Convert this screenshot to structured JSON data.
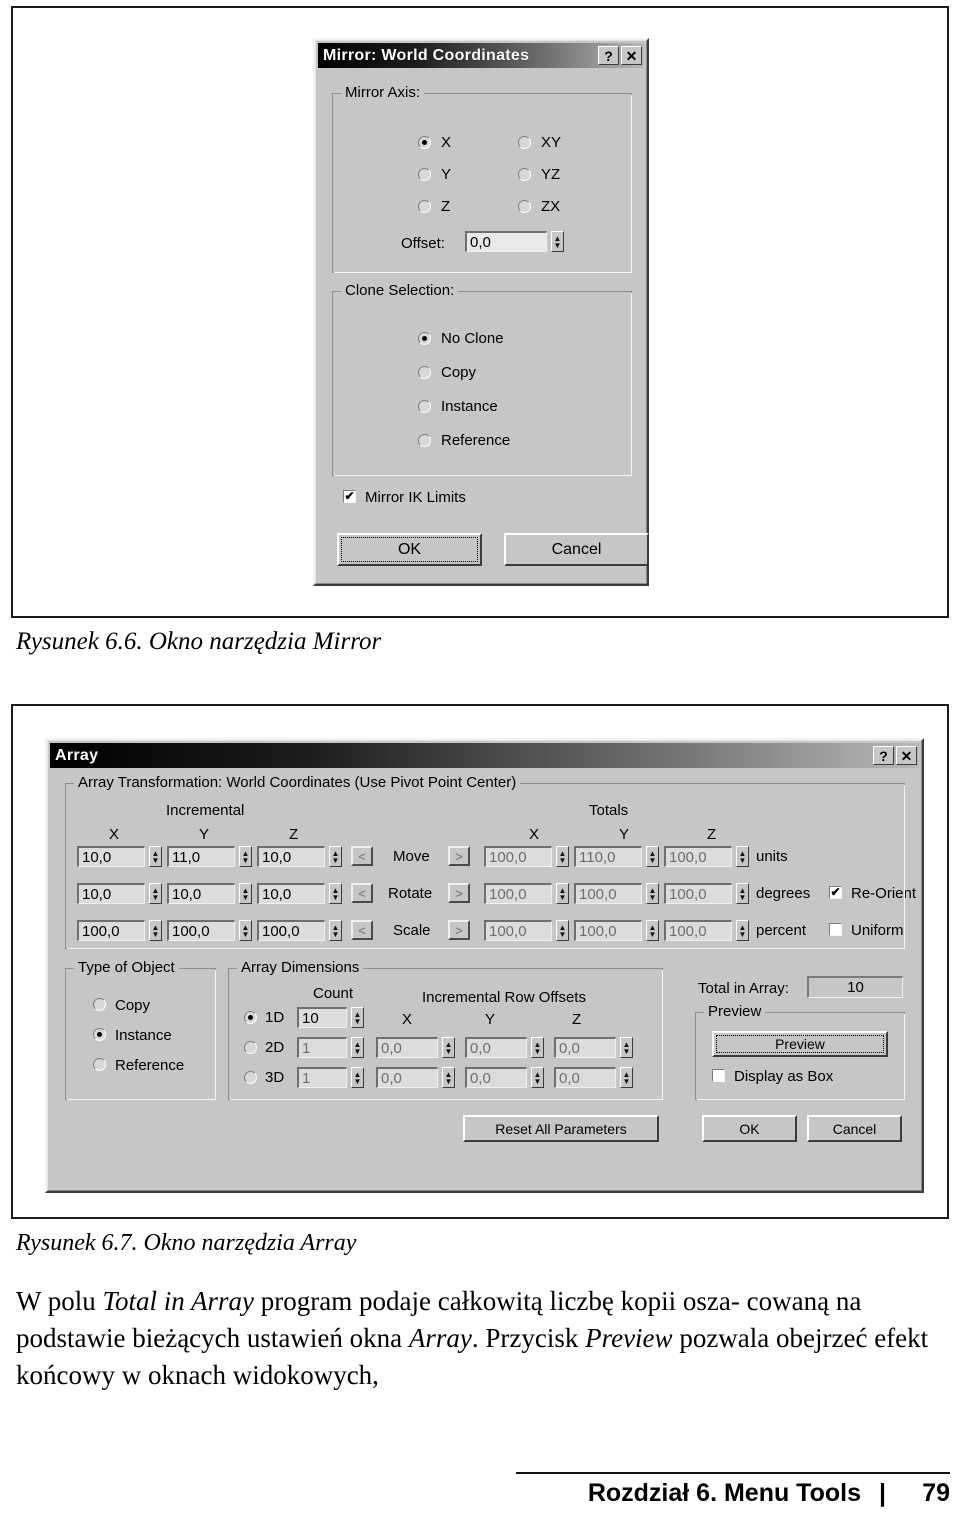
{
  "figures": [
    {
      "caption": "Rysunek 6.6. Okno narzędzia Mirror"
    },
    {
      "caption": "Rysunek 6.7. Okno narzędzia Array"
    }
  ],
  "mirror_dialog": {
    "title": "Mirror: World Coordinates",
    "help_button": "?",
    "close_button": "✕",
    "mirror_axis": {
      "group_label": "Mirror Axis:",
      "options": [
        {
          "label": "X",
          "selected": true
        },
        {
          "label": "Y",
          "selected": false
        },
        {
          "label": "Z",
          "selected": false
        },
        {
          "label": "XY",
          "selected": false
        },
        {
          "label": "YZ",
          "selected": false
        },
        {
          "label": "ZX",
          "selected": false
        }
      ],
      "offset_label": "Offset:",
      "offset_value": "0,0"
    },
    "clone_selection": {
      "group_label": "Clone Selection:",
      "options": [
        {
          "label": "No Clone",
          "selected": true
        },
        {
          "label": "Copy",
          "selected": false
        },
        {
          "label": "Instance",
          "selected": false
        },
        {
          "label": "Reference",
          "selected": false
        }
      ]
    },
    "mirror_ik_limits": {
      "label": "Mirror IK Limits",
      "checked": true,
      "mark": "✔"
    },
    "ok_label": "OK",
    "cancel_label": "Cancel"
  },
  "array_dialog": {
    "title": "Array",
    "help_button": "?",
    "close_button": "✕",
    "transformation": {
      "group_label": "Array Transformation: World Coordinates (Use Pivot Point Center)",
      "incremental_header": "Incremental",
      "totals_header": "Totals",
      "axis_headers": [
        "X",
        "Y",
        "Z"
      ],
      "arrow_left": "<",
      "arrow_right": ">",
      "rows": [
        {
          "name": "Move",
          "incremental": [
            "10,0",
            "11,0",
            "10,0"
          ],
          "totals": [
            "100,0",
            "110,0",
            "100,0"
          ],
          "unit": "units",
          "checkbox": null
        },
        {
          "name": "Rotate",
          "incremental": [
            "10,0",
            "10,0",
            "10,0"
          ],
          "totals": [
            "100,0",
            "100,0",
            "100,0"
          ],
          "unit": "degrees",
          "checkbox": {
            "label": "Re-Orient",
            "checked": true,
            "mark": "✔"
          }
        },
        {
          "name": "Scale",
          "incremental": [
            "100,0",
            "100,0",
            "100,0"
          ],
          "totals": [
            "100,0",
            "100,0",
            "100,0"
          ],
          "unit": "percent",
          "checkbox": {
            "label": "Uniform",
            "checked": false,
            "mark": ""
          }
        }
      ]
    },
    "type_of_object": {
      "group_label": "Type of Object",
      "options": [
        {
          "label": "Copy",
          "selected": false
        },
        {
          "label": "Instance",
          "selected": true
        },
        {
          "label": "Reference",
          "selected": false
        }
      ]
    },
    "array_dimensions": {
      "group_label": "Array Dimensions",
      "count_header": "Count",
      "offsets_header": "Incremental Row Offsets",
      "axis_headers": [
        "X",
        "Y",
        "Z"
      ],
      "rows": [
        {
          "label": "1D",
          "selected": true,
          "count": "10",
          "offsets": []
        },
        {
          "label": "2D",
          "selected": false,
          "count": "1",
          "offsets": [
            "0,0",
            "0,0",
            "0,0"
          ]
        },
        {
          "label": "3D",
          "selected": false,
          "count": "1",
          "offsets": [
            "0,0",
            "0,0",
            "0,0"
          ]
        }
      ]
    },
    "total_in_array": {
      "label": "Total in Array:",
      "value": "10"
    },
    "preview": {
      "group_label": "Preview",
      "button_label": "Preview",
      "display_as_box": {
        "label": "Display as Box",
        "checked": false,
        "mark": ""
      }
    },
    "reset_label": "Reset All Parameters",
    "ok_label": "OK",
    "cancel_label": "Cancel"
  },
  "body_text": {
    "line1_a": "W polu ",
    "line1_i": "Total in Array",
    "line1_b": " program podaje całkowitą liczbę kopii osza-",
    "line2_a": "cowaną na podstawie bieżących ustawień okna ",
    "line2_i": "Array",
    "line2_b": ". Przycisk",
    "line3_i": "Preview",
    "line3_b": " pozwala obejrzeć efekt końcowy w oknach widokowych,"
  },
  "footer": {
    "chapter": "Rozdział 6. Menu Tools",
    "separator": "|",
    "page_number": "79"
  }
}
